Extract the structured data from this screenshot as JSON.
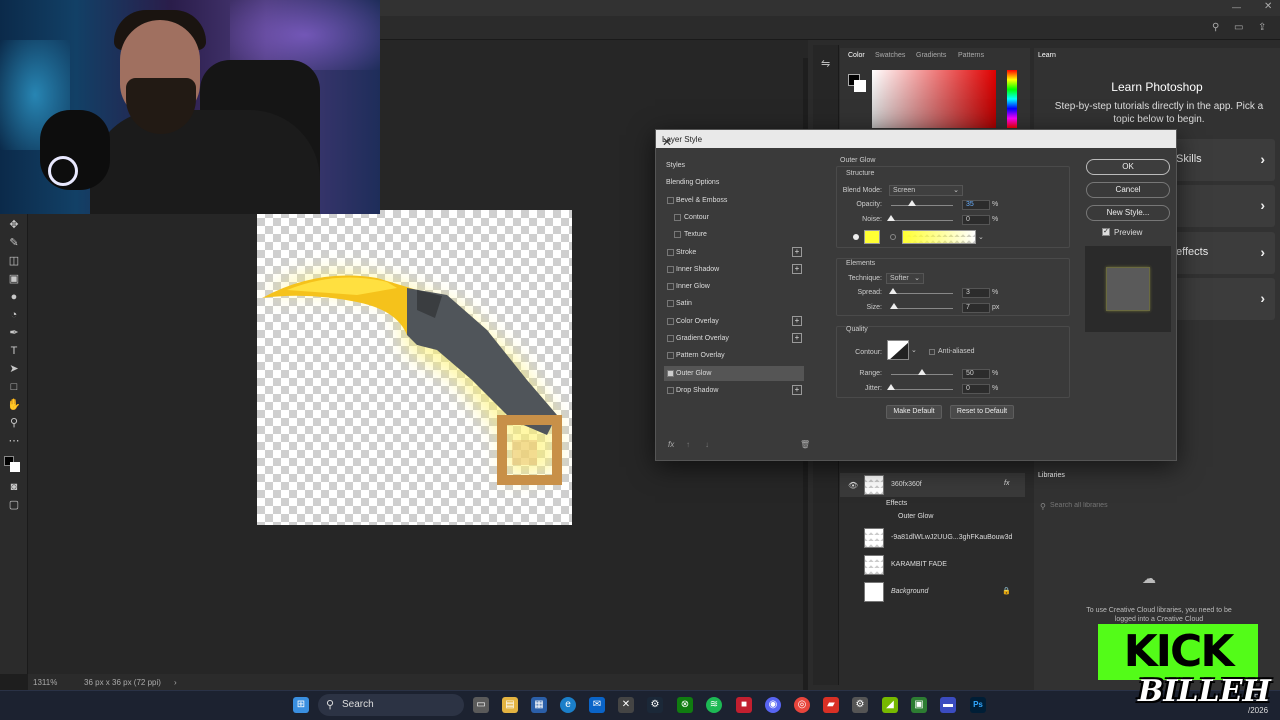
{
  "colors": {
    "accent": "#53fc18",
    "glow": "#ffff33",
    "dialog_bg": "#3a3a3a",
    "taskbar": "#1c2230"
  },
  "statusbar": {
    "zoom": "1311%",
    "doc_size": "36 px x 36 px (72 ppi)"
  },
  "color_panel": {
    "tabs": [
      "Color",
      "Swatches",
      "Gradients",
      "Patterns"
    ]
  },
  "learn": {
    "tab": "Learn",
    "title": "Learn Photoshop",
    "description": "Step-by-step tutorials directly in the app. Pick a topic below to begin.",
    "cards": [
      "Skills",
      "",
      "effects",
      ""
    ]
  },
  "layers": {
    "rows": [
      {
        "name": "360fx360f",
        "has_fx": true
      },
      {
        "name": "Effects"
      },
      {
        "name": "Outer Glow"
      },
      {
        "name": "-9a81dlWLwJ2UUG...3ghFKauBouw3d"
      },
      {
        "name": "KARAMBIT FADE"
      },
      {
        "name": "Background"
      }
    ]
  },
  "libraries": {
    "tab": "Libraries",
    "search_placeholder": "Search all libraries",
    "message": "To use Creative Cloud libraries, you need to be logged into a Creative Cloud"
  },
  "dialog": {
    "title": "Layer Style",
    "styles": [
      {
        "label": "Styles",
        "checkbox": false,
        "plus": false,
        "indent": false,
        "active": false
      },
      {
        "label": "Blending Options",
        "checkbox": false,
        "plus": false,
        "indent": false,
        "active": false
      },
      {
        "label": "Bevel & Emboss",
        "checkbox": true,
        "plus": false,
        "indent": false,
        "active": false
      },
      {
        "label": "Contour",
        "checkbox": true,
        "plus": false,
        "indent": true,
        "active": false
      },
      {
        "label": "Texture",
        "checkbox": true,
        "plus": false,
        "indent": true,
        "active": false
      },
      {
        "label": "Stroke",
        "checkbox": true,
        "plus": true,
        "indent": false,
        "active": false
      },
      {
        "label": "Inner Shadow",
        "checkbox": true,
        "plus": true,
        "indent": false,
        "active": false
      },
      {
        "label": "Inner Glow",
        "checkbox": true,
        "plus": false,
        "indent": false,
        "active": false
      },
      {
        "label": "Satin",
        "checkbox": true,
        "plus": false,
        "indent": false,
        "active": false
      },
      {
        "label": "Color Overlay",
        "checkbox": true,
        "plus": true,
        "indent": false,
        "active": false
      },
      {
        "label": "Gradient Overlay",
        "checkbox": true,
        "plus": true,
        "indent": false,
        "active": false
      },
      {
        "label": "Pattern Overlay",
        "checkbox": true,
        "plus": false,
        "indent": false,
        "active": false
      },
      {
        "label": "Outer Glow",
        "checkbox": true,
        "plus": false,
        "indent": false,
        "active": true
      },
      {
        "label": "Drop Shadow",
        "checkbox": true,
        "plus": true,
        "indent": false,
        "active": false
      }
    ],
    "footer_icons": [
      "fx",
      "↑",
      "↓",
      "trash"
    ],
    "section_title": "Outer Glow",
    "structure": {
      "title": "Structure",
      "blend_mode_label": "Blend Mode:",
      "blend_mode": "Screen",
      "opacity_label": "Opacity:",
      "opacity": "35",
      "noise_label": "Noise:",
      "noise": "0"
    },
    "elements": {
      "title": "Elements",
      "technique_label": "Technique:",
      "technique": "Softer",
      "spread_label": "Spread:",
      "spread": "3",
      "size_label": "Size:",
      "size": "7",
      "size_unit": "px"
    },
    "quality": {
      "title": "Quality",
      "contour_label": "Contour:",
      "anti_aliased": "Anti-aliased",
      "range_label": "Range:",
      "range": "50",
      "jitter_label": "Jitter:",
      "jitter": "0"
    },
    "percent": "%",
    "make_default": "Make Default",
    "reset_default": "Reset to Default",
    "ok": "OK",
    "cancel": "Cancel",
    "new_style": "New Style...",
    "preview": "Preview"
  },
  "taskbar": {
    "search": "Search",
    "time": "PM",
    "date": "/2026"
  },
  "overlay": {
    "brand": "KICK",
    "streamer": "BILLEH"
  }
}
